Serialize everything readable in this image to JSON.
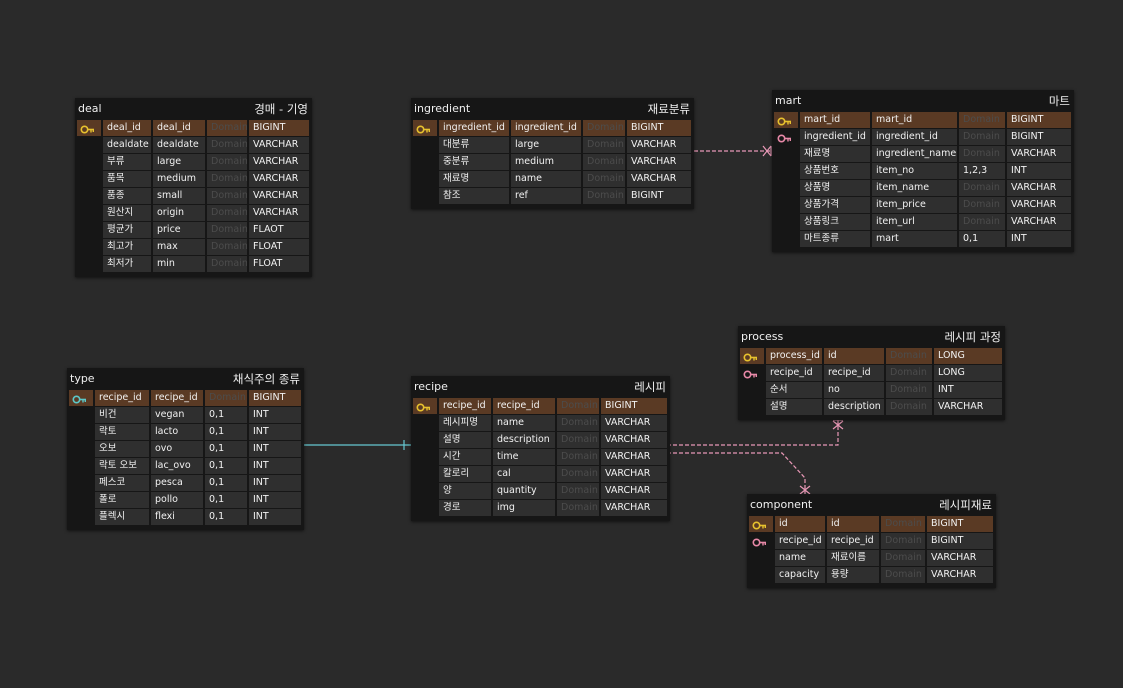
{
  "domain_placeholder": "Domain",
  "colors": {
    "background": "#2a2a2a",
    "table_body": "#161616",
    "cell": "#2f2f2f",
    "pk_row": "#5a3a24",
    "pk_key_icon": "#e8c22e",
    "fk_key_icon": "#e889a8",
    "type_key_icon": "#5cc8c8",
    "relation_pink": "#e898b6",
    "relation_teal": "#66c8d0"
  },
  "tables": {
    "deal": {
      "name": "deal",
      "logical": "경매 - 기영",
      "rows": [
        {
          "key": "pk",
          "col": "deal_id",
          "phys": "deal_id",
          "type": "BIGINT"
        },
        {
          "key": "",
          "col": "dealdate",
          "phys": "dealdate",
          "type": "VARCHAR"
        },
        {
          "key": "",
          "col": "부류",
          "phys": "large",
          "type": "VARCHAR"
        },
        {
          "key": "",
          "col": "품목",
          "phys": "medium",
          "type": "VARCHAR"
        },
        {
          "key": "",
          "col": "품종",
          "phys": "small",
          "type": "VARCHAR"
        },
        {
          "key": "",
          "col": "원산지",
          "phys": "origin",
          "type": "VARCHAR"
        },
        {
          "key": "",
          "col": "평균가",
          "phys": "price",
          "type": "FLAOT"
        },
        {
          "key": "",
          "col": "최고가",
          "phys": "max",
          "type": "FLOAT"
        },
        {
          "key": "",
          "col": "최저가",
          "phys": "min",
          "type": "FLOAT"
        }
      ]
    },
    "ingredient": {
      "name": "ingredient",
      "logical": "재료분류",
      "rows": [
        {
          "key": "pk",
          "col": "ingredient_id",
          "phys": "ingredient_id",
          "type": "BIGINT"
        },
        {
          "key": "",
          "col": "대분류",
          "phys": "large",
          "type": "VARCHAR"
        },
        {
          "key": "",
          "col": "중분류",
          "phys": "medium",
          "type": "VARCHAR"
        },
        {
          "key": "",
          "col": "재료명",
          "phys": "name",
          "type": "VARCHAR"
        },
        {
          "key": "",
          "col": "참조",
          "phys": "ref",
          "type": "BIGINT"
        }
      ]
    },
    "mart": {
      "name": "mart",
      "logical": "마트",
      "rows": [
        {
          "key": "pk",
          "col": "mart_id",
          "phys": "mart_id",
          "type": "BIGINT"
        },
        {
          "key": "fk",
          "col": "ingredient_id",
          "phys": "ingredient_id",
          "type": "BIGINT"
        },
        {
          "key": "",
          "col": "재료명",
          "phys": "ingredient_name",
          "type": "VARCHAR"
        },
        {
          "key": "",
          "col": "상품번호",
          "phys": "item_no",
          "dom": "1,2,3",
          "type": "INT"
        },
        {
          "key": "",
          "col": "상품명",
          "phys": "item_name",
          "type": "VARCHAR"
        },
        {
          "key": "",
          "col": "상품가격",
          "phys": "item_price",
          "type": "VARCHAR"
        },
        {
          "key": "",
          "col": "상품링크",
          "phys": "item_url",
          "type": "VARCHAR"
        },
        {
          "key": "",
          "col": "마트종류",
          "phys": "mart",
          "dom": "0,1",
          "type": "INT"
        }
      ]
    },
    "process": {
      "name": "process",
      "logical": "레시피 과정",
      "rows": [
        {
          "key": "pk",
          "col": "process_id",
          "phys": "id",
          "type": "LONG"
        },
        {
          "key": "fk",
          "col": "recipe_id",
          "phys": "recipe_id",
          "type": "LONG"
        },
        {
          "key": "",
          "col": "순서",
          "phys": "no",
          "type": "INT"
        },
        {
          "key": "",
          "col": "설명",
          "phys": "description",
          "type": "VARCHAR"
        }
      ]
    },
    "type": {
      "name": "type",
      "logical": "채식주의 종류",
      "rows": [
        {
          "key": "typekey",
          "col": "recipe_id",
          "phys": "recipe_id",
          "type": "BIGINT"
        },
        {
          "key": "",
          "col": "비건",
          "phys": "vegan",
          "dom": "0,1",
          "type": "INT"
        },
        {
          "key": "",
          "col": "락토",
          "phys": "lacto",
          "dom": "0,1",
          "type": "INT"
        },
        {
          "key": "",
          "col": "오보",
          "phys": "ovo",
          "dom": "0,1",
          "type": "INT"
        },
        {
          "key": "",
          "col": "락토 오보",
          "phys": "lac_ovo",
          "dom": "0,1",
          "type": "INT"
        },
        {
          "key": "",
          "col": "페스코",
          "phys": "pesca",
          "dom": "0,1",
          "type": "INT"
        },
        {
          "key": "",
          "col": "폴로",
          "phys": "pollo",
          "dom": "0,1",
          "type": "INT"
        },
        {
          "key": "",
          "col": "플렉시",
          "phys": "flexi",
          "dom": "0,1",
          "type": "INT"
        }
      ]
    },
    "recipe": {
      "name": "recipe",
      "logical": "레시피",
      "rows": [
        {
          "key": "pk",
          "col": "recipe_id",
          "phys": "recipe_id",
          "type": "BIGINT"
        },
        {
          "key": "",
          "col": "레시피명",
          "phys": "name",
          "type": "VARCHAR"
        },
        {
          "key": "",
          "col": "설명",
          "phys": "description",
          "type": "VARCHAR"
        },
        {
          "key": "",
          "col": "시간",
          "phys": "time",
          "type": "VARCHAR"
        },
        {
          "key": "",
          "col": "칼로리",
          "phys": "cal",
          "type": "VARCHAR"
        },
        {
          "key": "",
          "col": "양",
          "phys": "quantity",
          "type": "VARCHAR"
        },
        {
          "key": "",
          "col": "경로",
          "phys": "img",
          "type": "VARCHAR"
        }
      ]
    },
    "component": {
      "name": "component",
      "logical": "레시피재료",
      "rows": [
        {
          "key": "pk",
          "col": "id",
          "phys": "id",
          "type": "BIGINT"
        },
        {
          "key": "fk",
          "col": "recipe_id",
          "phys": "recipe_id",
          "type": "BIGINT"
        },
        {
          "key": "",
          "col": "name",
          "phys": "재료이름",
          "type": "VARCHAR"
        },
        {
          "key": "",
          "col": "capacity",
          "phys": "용량",
          "type": "VARCHAR"
        }
      ]
    }
  }
}
